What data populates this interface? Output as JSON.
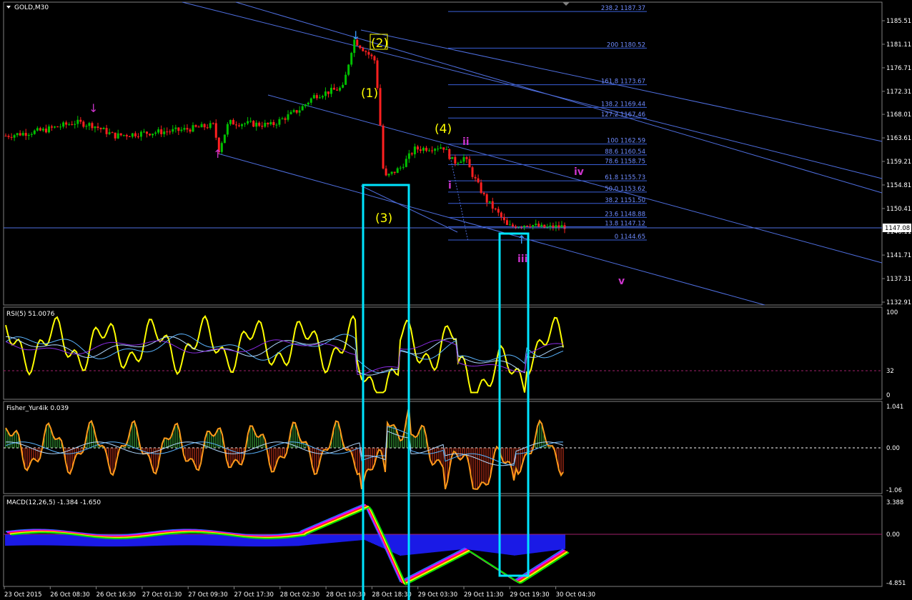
{
  "colors": {
    "background": "#000000",
    "grid_border": "#ffffff",
    "channel": "#4f6fe0",
    "fib": "#3a5fd8",
    "fib_text": "#6f8cff",
    "bull": "#00c000",
    "bear": "#ff2020",
    "wave_main": "#ffff00",
    "wave_minor": "#cc33cc",
    "cyan_box": "#00e5ff",
    "rsi_line": "#ffff00",
    "price_line": "#4f6fe0"
  },
  "main_panel": {
    "title": "GOLD,M30",
    "price_ticks": [
      "1185.51",
      "1181.11",
      "1176.71",
      "1172.31",
      "1168.01",
      "1163.61",
      "1159.21",
      "1154.81",
      "1150.41",
      "1146.11",
      "1141.71",
      "1137.31",
      "1132.91"
    ],
    "current_price": "1147.08",
    "fib_levels": [
      {
        "label": "238.2  1187.37",
        "price": 1187.37
      },
      {
        "label": "200  1180.52",
        "price": 1180.52
      },
      {
        "label": "161.8  1173.67",
        "price": 1173.67
      },
      {
        "label": "138.2  1169.44",
        "price": 1169.44
      },
      {
        "label": "127.2  1167.46",
        "price": 1167.46
      },
      {
        "label": "100  1162.59",
        "price": 1162.59
      },
      {
        "label": "88.6  1160.54",
        "price": 1160.54
      },
      {
        "label": "78.6  1158.75",
        "price": 1158.75
      },
      {
        "label": "61.8  1155.73",
        "price": 1155.73
      },
      {
        "label": "50.0  1153.62",
        "price": 1153.62
      },
      {
        "label": "38.2  1151.50",
        "price": 1151.5
      },
      {
        "label": "23.6  1148.88",
        "price": 1148.88
      },
      {
        "label": "13.8  1147.12",
        "price": 1147.12
      },
      {
        "label": "0  1144.65",
        "price": 1144.65
      }
    ],
    "wave_labels_main": [
      "(2)",
      "(1)",
      "(4)",
      "(3)"
    ],
    "wave_labels_minor": [
      "ii",
      "i",
      "iv",
      "iii",
      "v"
    ]
  },
  "rsi_panel": {
    "title": "RSI(5) 51.0076",
    "ticks": [
      "100",
      "32",
      "0"
    ]
  },
  "fisher_panel": {
    "title": "Fisher_Yur4ik 0.039",
    "ticks": [
      "1.041",
      "0.00",
      "-1.06"
    ]
  },
  "macd_panel": {
    "title": "MACD(12,26,5) -1.384 -1.650",
    "ticks": [
      "3.388",
      "0.00",
      "-4.851"
    ]
  },
  "time_axis": [
    "23 Oct 2015",
    "26 Oct 08:30",
    "26 Oct 16:30",
    "27 Oct 01:30",
    "27 Oct 09:30",
    "27 Oct 17:30",
    "28 Oct 02:30",
    "28 Oct 10:30",
    "28 Oct 18:30",
    "29 Oct 03:30",
    "29 Oct 11:30",
    "29 Oct 19:30",
    "30 Oct 04:30"
  ],
  "chart_data": {
    "type": "candlestick",
    "symbol": "GOLD",
    "timeframe": "M30",
    "ylim": [
      1132.91,
      1189.0
    ],
    "close_points": [
      [
        "23 Oct 2015",
        1164.5
      ],
      [
        "26 Oct 08:30",
        1165.5
      ],
      [
        "26 Oct 16:30",
        1164.0
      ],
      [
        "27 Oct 01:30",
        1165.0
      ],
      [
        "27 Oct 09:30",
        1166.5
      ],
      [
        "27 Oct 17:30",
        1165.5
      ],
      [
        "28 Oct 02:30",
        1171.0
      ],
      [
        "28 Oct 10:30",
        1182.5
      ],
      [
        "28 Oct 18:30",
        1156.5
      ],
      [
        "29 Oct 03:30",
        1161.0
      ],
      [
        "29 Oct 11:30",
        1151.0
      ],
      [
        "29 Oct 19:30",
        1147.0
      ],
      [
        "30 Oct 04:30",
        1147.08
      ]
    ],
    "rsi_period": 5,
    "rsi_last": 51.0076,
    "rsi_level": 32,
    "fisher_last": 0.039,
    "macd_params": [
      12,
      26,
      5
    ],
    "macd_main": -1.384,
    "macd_signal": -1.65,
    "grid": false
  }
}
